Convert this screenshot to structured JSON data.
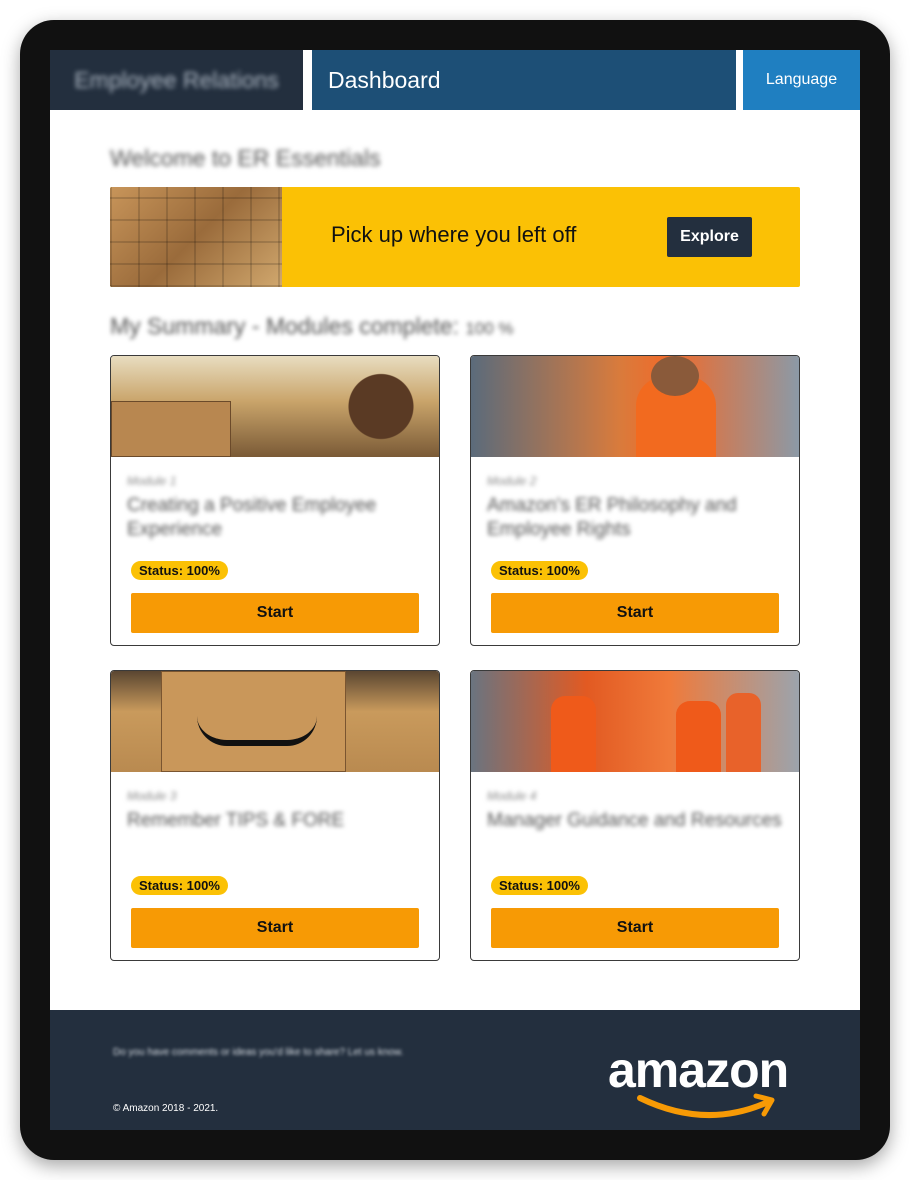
{
  "header": {
    "brand": "Employee Relations",
    "page": "Dashboard",
    "language": "Language"
  },
  "welcome": "Welcome to ER Essentials",
  "banner": {
    "text": "Pick up where you left off",
    "button": "Explore"
  },
  "summary": {
    "label": "My Summary - Modules complete:",
    "percent": "100 %"
  },
  "modules": [
    {
      "number": "Module 1",
      "title": "Creating a Positive Employee Experience",
      "status": "Status: 100%",
      "button": "Start"
    },
    {
      "number": "Module 2",
      "title": "Amazon's ER Philosophy and Employee Rights",
      "status": "Status: 100%",
      "button": "Start"
    },
    {
      "number": "Module 3",
      "title": "Remember TIPS & FORE",
      "status": "Status: 100%",
      "button": "Start"
    },
    {
      "number": "Module 4",
      "title": "Manager Guidance and Resources",
      "status": "Status: 100%",
      "button": "Start"
    }
  ],
  "footer": {
    "comment": "Do you have comments or ideas you'd like to share? Let us know.",
    "copyright": "© Amazon 2018 - 2021.",
    "logo": "amazon"
  },
  "colors": {
    "nav_dark": "#232f3e",
    "nav_blue": "#1d4f76",
    "nav_light_blue": "#1f7fc1",
    "accent_yellow": "#fbc105",
    "button_orange": "#f79a05"
  }
}
